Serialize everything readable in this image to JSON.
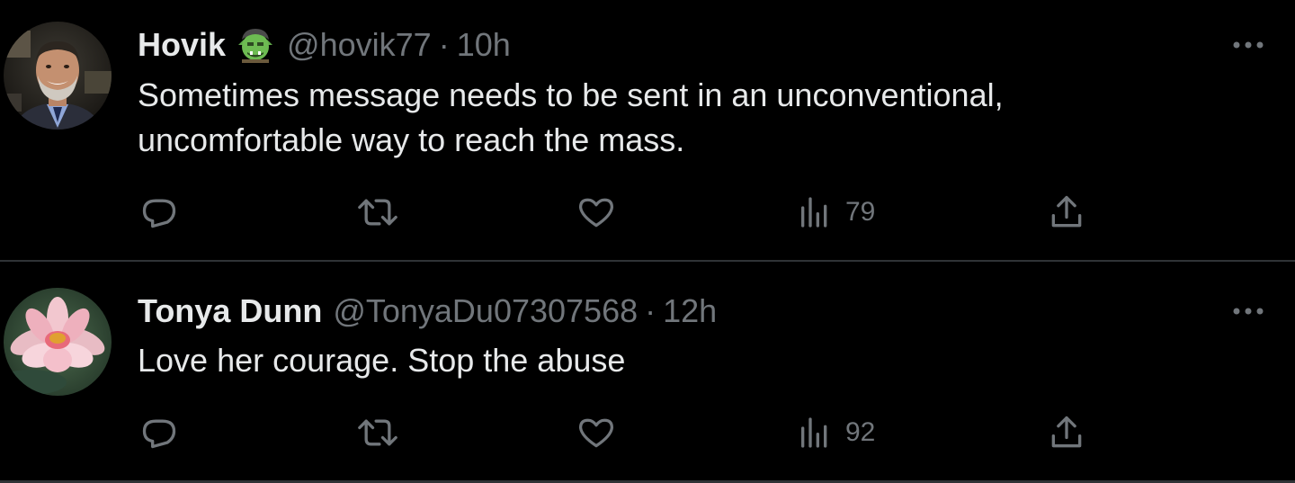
{
  "tweets": [
    {
      "display_name": "Hovik",
      "emoji": "ogre-emoji-icon",
      "handle": "@hovik77",
      "separator": "·",
      "time": "10h",
      "text_lines": [
        "Sometimes message needs to be sent in an unconventional,",
        "uncomfortable way to reach the mass."
      ],
      "views": "79",
      "avatar": "man-portrait-avatar"
    },
    {
      "display_name": "Tonya Dunn",
      "handle": "@TonyaDu07307568",
      "separator": "·",
      "time": "12h",
      "text_lines": [
        "Love her courage. Stop the abuse"
      ],
      "views": "92",
      "avatar": "lotus-flower-avatar"
    }
  ],
  "colors": {
    "background": "#000000",
    "text": "#e7e9ea",
    "secondary": "#71767b",
    "divider": "#2f3336"
  },
  "icons": {
    "reply": "reply-icon",
    "retweet": "retweet-icon",
    "like": "heart-icon",
    "views": "views-bar-chart-icon",
    "share": "share-icon",
    "more": "more-dots-icon"
  }
}
